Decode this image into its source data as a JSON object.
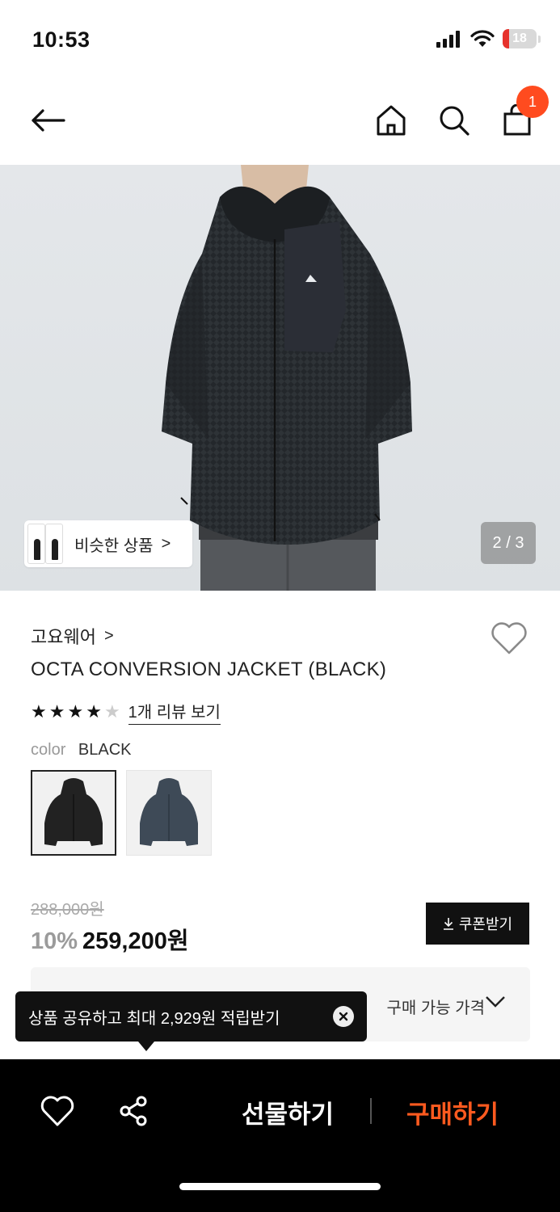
{
  "status_bar": {
    "time": "10:53",
    "battery_level": "18",
    "battery_fraction": 0.18
  },
  "nav": {
    "cart_count": "1"
  },
  "hero": {
    "similar_label": "비슷한 상품",
    "similar_arrow": ">",
    "page_indicator": "2 / 3"
  },
  "product": {
    "brand": "고요웨어",
    "brand_arrow": ">",
    "name": "OCTA CONVERSION JACKET (BLACK)",
    "rating": 4,
    "rating_max": 5,
    "review_link": "1개 리뷰 보기",
    "color_label": "color",
    "color_value": "BLACK",
    "swatches": [
      {
        "name": "black",
        "color": "#222222",
        "selected": true
      },
      {
        "name": "navy",
        "color": "#3e4a57",
        "selected": false
      }
    ],
    "original_price": "288,000원",
    "discount": "10%",
    "sale_price": "259,200원",
    "coupon_label": "쿠폰받기",
    "available_price_label": "구매 가능 가격"
  },
  "toast": {
    "text": "상품 공유하고 최대 2,929원 적립받기"
  },
  "bottom_bar": {
    "gift_label": "선물하기",
    "buy_label": "구매하기"
  },
  "colors": {
    "accent": "#ff5a1f",
    "badge": "#ff4b1f",
    "star_on": "#111111",
    "star_off": "#cccccc"
  }
}
